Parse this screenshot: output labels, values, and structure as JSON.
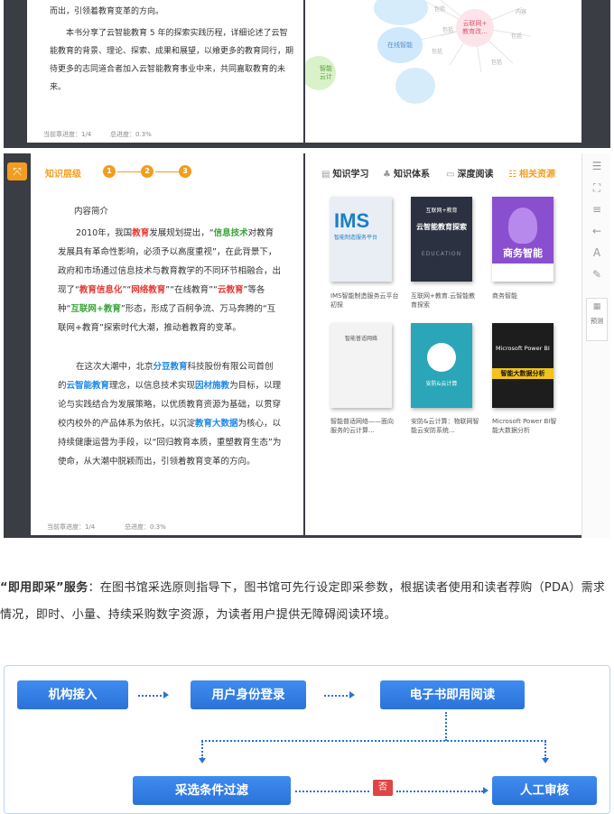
{
  "top_screen": {
    "paragraph_tail": "而出，引领着教育变革的方向。",
    "paragraph2": "本书分享了云智能教育 5 年的探索实践历程，详细论述了云智能教育的背景、理论、探索、成果和展望，以飨更多的教育同行，期待更多的志同道合者加入云智能教育事业中来，共同嘉取教育的未来。",
    "footer_chapter": "当前章进度：1/4",
    "footer_total": "总进度：0.3%",
    "mindmap": {
      "center": "云联网+\n教育改...",
      "node_left": "在线智能",
      "node_edge": "智能\n云计",
      "spoke_labels": [
        "内容",
        "包括",
        "包括",
        "包括",
        "包括",
        "包括",
        "包括",
        "包括",
        "包括"
      ]
    }
  },
  "reader": {
    "level_label": "知识层级",
    "steps": [
      "1",
      "2",
      "3"
    ],
    "intro_title": "内容简介",
    "p1": [
      {
        "t": "2010年，我国",
        "c": ""
      },
      {
        "t": "教育",
        "c": "hl-red"
      },
      {
        "t": "发展规划提出，“",
        "c": ""
      },
      {
        "t": "信息技术",
        "c": "hl-green"
      },
      {
        "t": "对教育发展具有革命性影响，必须予以高度重视”，在此背景下，政府和市场通过信息技术与教育教学的不同环节相融合，出现了“",
        "c": ""
      },
      {
        "t": "教育信息化",
        "c": "hl-red"
      },
      {
        "t": "”“",
        "c": ""
      },
      {
        "t": "网络教育",
        "c": "hl-red"
      },
      {
        "t": "”“在线教育”“",
        "c": ""
      },
      {
        "t": "云教育",
        "c": "hl-red"
      },
      {
        "t": "”等各种“",
        "c": ""
      },
      {
        "t": "互联网+教育",
        "c": "hl-green"
      },
      {
        "t": "”形态，形成了百舸争流、万马奔腾的“互联网+教育”探索时代大潮，推动着教育的变革。",
        "c": ""
      }
    ],
    "p2": [
      {
        "t": "在这次大潮中，北京",
        "c": ""
      },
      {
        "t": "分豆教育",
        "c": "hl-blue"
      },
      {
        "t": "科技股份有限公司首创的",
        "c": ""
      },
      {
        "t": "云智能教育",
        "c": "hl-blue"
      },
      {
        "t": "理念，以信息技术实现",
        "c": ""
      },
      {
        "t": "因材施教",
        "c": "hl-blue"
      },
      {
        "t": "为目标，以理论与实践结合为发展策略，以优质教育资源为基础，以贯穿校内校外的产品体系为依托，以沉淀",
        "c": ""
      },
      {
        "t": "教育大数据",
        "c": "hl-blue"
      },
      {
        "t": "为核心，以持续健康运营为手段，以“回归教育本质，重塑教育生态”为使命，从大潮中脱颖而出，引领着教育变革的方向。",
        "c": ""
      }
    ],
    "footer_chapter": "当前章进度：1/4",
    "footer_total": "总进度：0.3%",
    "tabs": [
      {
        "icon": "list-icon",
        "label": "知识学习"
      },
      {
        "icon": "hierarchy-icon",
        "label": "知识体系"
      },
      {
        "icon": "doc-icon",
        "label": "深度阅读"
      },
      {
        "icon": "resource-icon",
        "label": "相关资源"
      }
    ],
    "books": [
      {
        "cover_title": "IMS",
        "cover_sub": "智能制造服务平台",
        "caption": "IMS智能制造服务云平台初探",
        "bg": "#e9eef4"
      },
      {
        "cover_title": "云智能教育探索",
        "cover_sub": "EDUCATION",
        "cover_top": "互联网+教育",
        "caption": "互联网+教育.云智能教育探索",
        "bg": "#2b3140"
      },
      {
        "cover_title": "商务智能",
        "cover_sub": "",
        "caption": "商务智能",
        "bg": "#8a4fcf"
      },
      {
        "cover_title": "智能普适网络",
        "cover_sub": "",
        "caption": "智能普适网络——面向服务的云计算...",
        "bg": "#f3f3f3"
      },
      {
        "cover_title": "安防&云计算",
        "cover_sub": "",
        "caption": "安防&云计算：物联网智能云安防系统...",
        "bg": "#2aa6b8"
      },
      {
        "cover_title": "Microsoft Power BI",
        "cover_sub": "智能大数据分析",
        "caption": "Microsoft Power BI智能大数据分析",
        "bg": "#1d1d1d"
      }
    ],
    "side_toolbar": {
      "bottom_label": "预测"
    }
  },
  "description": {
    "lead": "“即用即采”服务",
    "text": "：在图书馆采选原则指导下，图书馆可先行设定即采参数，根据读者使用和读者荐购（PDA）需求情况，即时、小量、持续采购数字资源，为读者用户提供无障碍阅读环境。"
  },
  "flow": {
    "box1": "机构接入",
    "box2": "用户身份登录",
    "box3": "电子书即用阅读",
    "box4": "采选条件过滤",
    "box5": "人工审核",
    "no_label": "否"
  }
}
